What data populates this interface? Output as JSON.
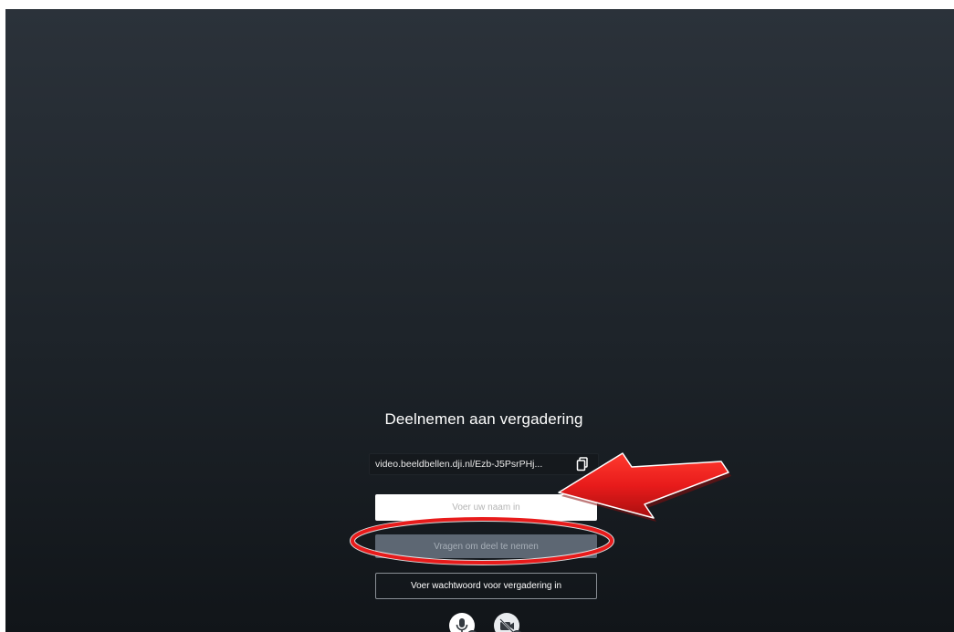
{
  "prejoin": {
    "title": "Deelnemen aan vergadering",
    "meeting_url": "video.beeldbellen.dji.nl/Ezb-J5PsrPHj...",
    "name_input": {
      "value": "",
      "placeholder": "Voer uw naam in"
    },
    "join_button_label": "Vragen om deel te nemen",
    "password_button_label": "Voer wachtwoord voor vergadering in"
  },
  "media_controls": {
    "microphone": {
      "icon": "microphone-icon",
      "state": "on"
    },
    "camera": {
      "icon": "camera-off-icon",
      "state": "off"
    }
  },
  "annotations": {
    "arrow_color": "#e81b1b",
    "ellipse_color": "#e81b1b"
  },
  "colors": {
    "background_top": "#2b323a",
    "background_bottom": "#111519",
    "join_button": "#5d6773"
  }
}
